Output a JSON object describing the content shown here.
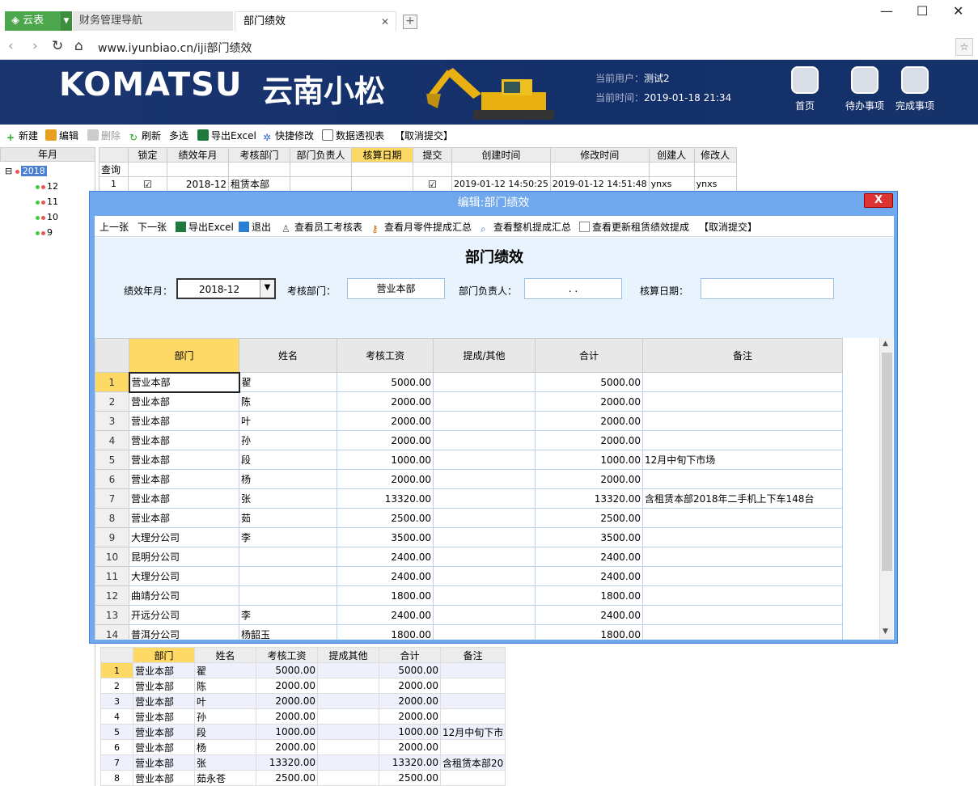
{
  "browser": {
    "tabs": [
      {
        "label": "云表"
      },
      {
        "label": "财务管理导航"
      },
      {
        "label": "部门绩效"
      }
    ],
    "url": "www.iyunbiao.cn/iji部门绩效"
  },
  "banner": {
    "logo": "KOMATSU",
    "logo_cn": "云南小松",
    "user_label": "当前用户：",
    "user": "测试2",
    "time_label": "当前时间：",
    "time": "2019-01-18 21:34",
    "buttons": [
      "首页",
      "待办事项",
      "完成事项"
    ]
  },
  "toolbar": [
    "新建",
    "编辑",
    "删除",
    "刷新",
    "多选",
    "导出Excel",
    "快捷修改",
    "数据透视表",
    "【取消提交】"
  ],
  "tree": {
    "header": "年月",
    "root": "2018",
    "children": [
      "12",
      "11",
      "10",
      "9"
    ]
  },
  "bg_grid": {
    "headers": [
      "锁定",
      "绩效年月",
      "考核部门",
      "部门负责人",
      "核算日期",
      "提交",
      "创建时间",
      "修改时间",
      "创建人",
      "修改人"
    ],
    "query_label": "查询",
    "row": {
      "num": "1",
      "month": "2018-12",
      "dept": "租赁本部",
      "created": "2019-01-12 14:50:25",
      "modified": "2019-01-12 14:51:48",
      "creator": "ynxs",
      "modifier": "ynxs"
    }
  },
  "dialog": {
    "title": "编辑:部门绩效",
    "close": "X",
    "tools": [
      "上一张",
      "下一张",
      "导出Excel",
      "退出",
      "查看员工考核表",
      "查看月零件提成汇总",
      "查看整机提成汇总",
      "查看更新租赁绩效提成",
      "【取消提交】"
    ],
    "form_title": "部门绩效",
    "fields": {
      "month_label": "绩效年月：",
      "month": "2018-12",
      "dept_label": "考核部门：",
      "dept": "营业本部",
      "head_label": "部门负责人：",
      "head": ". .",
      "date_label": "核算日期：",
      "date": ""
    },
    "grid_headers": [
      "部门",
      "姓名",
      "考核工资",
      "提成/其他",
      "合计",
      "备注"
    ],
    "rows": [
      {
        "n": "1",
        "dept": "营业本部",
        "name": "翟",
        "salary": "5000.00",
        "other": "",
        "total": "5000.00",
        "note": ""
      },
      {
        "n": "2",
        "dept": "营业本部",
        "name": "陈",
        "salary": "2000.00",
        "other": "",
        "total": "2000.00",
        "note": ""
      },
      {
        "n": "3",
        "dept": "营业本部",
        "name": "叶",
        "salary": "2000.00",
        "other": "",
        "total": "2000.00",
        "note": ""
      },
      {
        "n": "4",
        "dept": "营业本部",
        "name": "孙",
        "salary": "2000.00",
        "other": "",
        "total": "2000.00",
        "note": ""
      },
      {
        "n": "5",
        "dept": "营业本部",
        "name": "段",
        "salary": "1000.00",
        "other": "",
        "total": "1000.00",
        "note": "12月中旬下市场"
      },
      {
        "n": "6",
        "dept": "营业本部",
        "name": "杨",
        "salary": "2000.00",
        "other": "",
        "total": "2000.00",
        "note": ""
      },
      {
        "n": "7",
        "dept": "营业本部",
        "name": "张",
        "salary": "13320.00",
        "other": "",
        "total": "13320.00",
        "note": "含租赁本部2018年二手机上下车148台"
      },
      {
        "n": "8",
        "dept": "营业本部",
        "name": "茹",
        "salary": "2500.00",
        "other": "",
        "total": "2500.00",
        "note": ""
      },
      {
        "n": "9",
        "dept": "大理分公司",
        "name": "李",
        "salary": "3500.00",
        "other": "",
        "total": "3500.00",
        "note": ""
      },
      {
        "n": "10",
        "dept": "昆明分公司",
        "name": "",
        "salary": "2400.00",
        "other": "",
        "total": "2400.00",
        "note": ""
      },
      {
        "n": "11",
        "dept": "大理分公司",
        "name": "",
        "salary": "2400.00",
        "other": "",
        "total": "2400.00",
        "note": ""
      },
      {
        "n": "12",
        "dept": "曲靖分公司",
        "name": "",
        "salary": "1800.00",
        "other": "",
        "total": "1800.00",
        "note": ""
      },
      {
        "n": "13",
        "dept": "开远分公司",
        "name": "李",
        "salary": "2400.00",
        "other": "",
        "total": "2400.00",
        "note": ""
      },
      {
        "n": "14",
        "dept": "普洱分公司",
        "name": "杨韶玉",
        "salary": "1800.00",
        "other": "",
        "total": "1800.00",
        "note": ""
      }
    ]
  },
  "bottom_grid": {
    "headers": [
      "部门",
      "姓名",
      "考核工资",
      "提成其他",
      "合计",
      "备注"
    ],
    "rows": [
      {
        "n": "1",
        "dept": "营业本部",
        "name": "翟",
        "salary": "5000.00",
        "other": "",
        "total": "5000.00",
        "note": ""
      },
      {
        "n": "2",
        "dept": "营业本部",
        "name": "陈",
        "salary": "2000.00",
        "other": "",
        "total": "2000.00",
        "note": ""
      },
      {
        "n": "3",
        "dept": "营业本部",
        "name": "叶",
        "salary": "2000.00",
        "other": "",
        "total": "2000.00",
        "note": ""
      },
      {
        "n": "4",
        "dept": "营业本部",
        "name": "孙",
        "salary": "2000.00",
        "other": "",
        "total": "2000.00",
        "note": ""
      },
      {
        "n": "5",
        "dept": "营业本部",
        "name": "段",
        "salary": "1000.00",
        "other": "",
        "total": "1000.00",
        "note": "12月中旬下市"
      },
      {
        "n": "6",
        "dept": "营业本部",
        "name": "杨",
        "salary": "2000.00",
        "other": "",
        "total": "2000.00",
        "note": ""
      },
      {
        "n": "7",
        "dept": "营业本部",
        "name": "张",
        "salary": "13320.00",
        "other": "",
        "total": "13320.00",
        "note": "含租赁本部20"
      },
      {
        "n": "8",
        "dept": "营业本部",
        "name": "茹永苍",
        "salary": "2500.00",
        "other": "",
        "total": "2500.00",
        "note": ""
      }
    ]
  },
  "colors": {
    "banner": "#1a3570",
    "dialog_frame": "#6fa8ec",
    "active_header": "#ffd966",
    "tab_green": "#4ca64c"
  }
}
